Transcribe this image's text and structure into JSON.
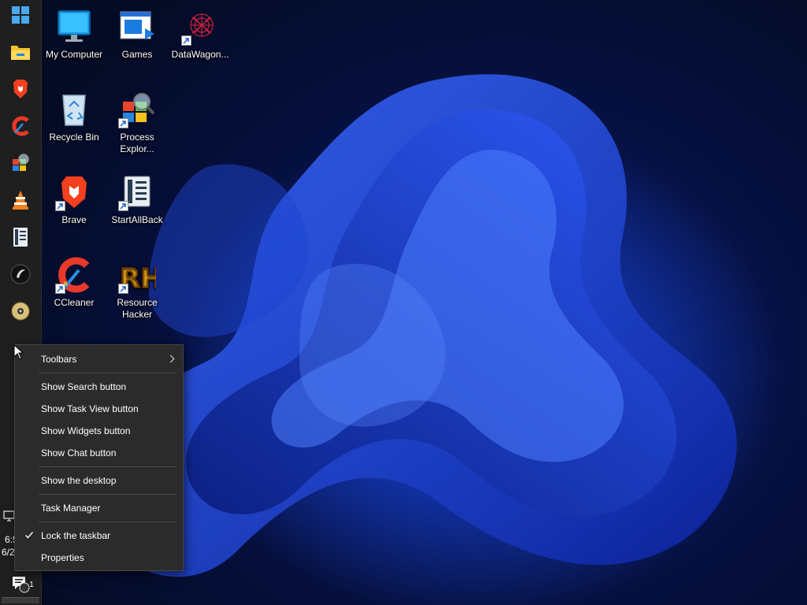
{
  "desktop": {
    "icons": [
      {
        "label": "My Computer",
        "icon": "monitor-icon"
      },
      {
        "label": "Games",
        "icon": "games-icon"
      },
      {
        "label": "DataWagon...",
        "icon": "datawagon-icon"
      },
      {
        "label": "Recycle Bin",
        "icon": "recycle-bin-icon"
      },
      {
        "label": "Process Explor...",
        "icon": "process-explorer-icon"
      },
      {
        "label": "Brave",
        "icon": "brave-icon"
      },
      {
        "label": "StartAllBack",
        "icon": "startallback-icon"
      },
      {
        "label": "CCleaner",
        "icon": "ccleaner-icon"
      },
      {
        "label": "Resource Hacker",
        "icon": "resource-hacker-icon"
      }
    ]
  },
  "taskbar": {
    "items": [
      {
        "icon": "windows-start-icon"
      },
      {
        "icon": "file-explorer-icon"
      },
      {
        "icon": "brave-icon"
      },
      {
        "icon": "ccleaner-icon"
      },
      {
        "icon": "process-explorer-icon"
      },
      {
        "icon": "vlc-icon"
      },
      {
        "icon": "startallback-icon"
      },
      {
        "icon": "app-circle-icon"
      },
      {
        "icon": "disc-icon"
      }
    ],
    "clock": {
      "time": "6:5",
      "date": "6/2"
    },
    "notification_count": "1"
  },
  "context_menu": {
    "items": [
      {
        "label": "Toolbars",
        "submenu": true
      },
      {
        "label": "Show Search button"
      },
      {
        "label": "Show Task View button"
      },
      {
        "label": "Show Widgets button"
      },
      {
        "label": "Show Chat button"
      },
      {
        "label": "Show the desktop"
      },
      {
        "label": "Task Manager"
      },
      {
        "label": "Lock the taskbar",
        "checked": true
      },
      {
        "label": "Properties"
      }
    ]
  },
  "colors": {
    "taskbar_bg": "#1f1f1f",
    "menu_bg": "#2b2b2b",
    "wallpaper_accent": "#1a3fd6"
  }
}
